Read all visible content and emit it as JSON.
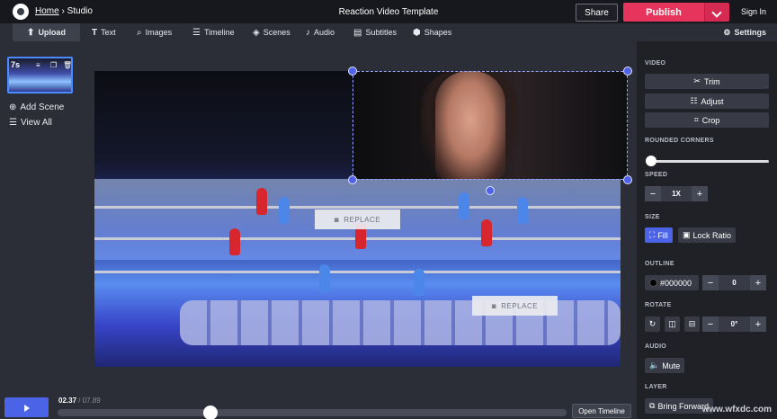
{
  "header": {
    "breadcrumb_home": "Home",
    "breadcrumb_sep": "›",
    "breadcrumb_current": "Studio",
    "title": "Reaction Video Template",
    "share": "Share",
    "publish": "Publish",
    "signin": "Sign In"
  },
  "toolbar": {
    "upload": "Upload",
    "text": "Text",
    "images": "Images",
    "timeline": "Timeline",
    "scenes": "Scenes",
    "audio": "Audio",
    "subtitles": "Subtitles",
    "shapes": "Shapes",
    "settings": "Settings"
  },
  "scenes": {
    "duration": "7s",
    "add_scene": "Add Scene",
    "view_all": "View All"
  },
  "canvas": {
    "replace_1": "REPLACE",
    "replace_2": "REPLACE"
  },
  "timeline": {
    "current": "02.37",
    "separator": "/",
    "total": "07.89",
    "open_timeline": "Open Timeline",
    "progress": 0.3
  },
  "panel": {
    "video_label": "VIDEO",
    "trim": "Trim",
    "adjust": "Adjust",
    "crop": "Crop",
    "rounded_label": "ROUNDED CORNERS",
    "speed_label": "SPEED",
    "speed_value": "1X",
    "size_label": "SIZE",
    "fill": "Fill",
    "lock_ratio": "Lock Ratio",
    "outline_label": "OUTLINE",
    "outline_color": "#000000",
    "outline_width": "0",
    "rotate_label": "ROTATE",
    "rotate_value": "0°",
    "audio_label": "AUDIO",
    "mute": "Mute",
    "layer_label": "LAYER",
    "bring_forward": "Bring Forward"
  },
  "watermark": "www.wfxdc.com",
  "colors": {
    "accent": "#4b63e6",
    "publish": "#e7345c",
    "panel_bg": "#1f2127"
  }
}
